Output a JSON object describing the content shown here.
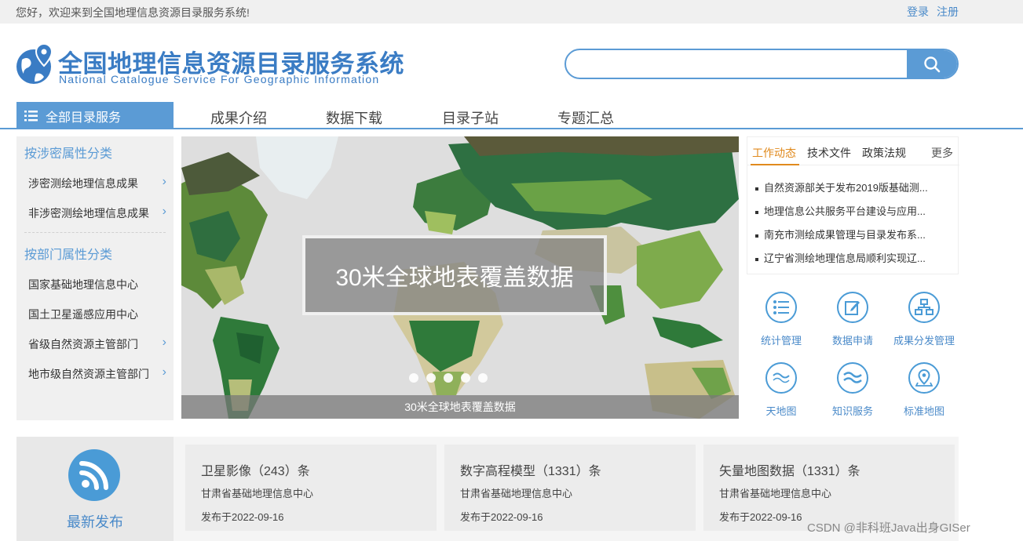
{
  "topbar": {
    "welcome": "您好，欢迎来到全国地理信息资源目录服务系统!",
    "login": "登录",
    "register": "注册"
  },
  "header": {
    "title": "全国地理信息资源目录服务系统",
    "subtitle": "National Catalogue Service For Geographic Information",
    "search_placeholder": "",
    "search_value": "",
    "search_icon": "search-icon",
    "logo_icon": "globe-pin-icon"
  },
  "nav": {
    "all_label": "全部目录服务",
    "items": [
      "成果介绍",
      "数据下载",
      "目录子站",
      "专题汇总"
    ]
  },
  "sidebar": {
    "group1_title": "按涉密属性分类",
    "group1_items": [
      "涉密测绘地理信息成果",
      "非涉密测绘地理信息成果"
    ],
    "group2_title": "按部门属性分类",
    "group2_items": [
      "国家基础地理信息中心",
      "国土卫星遥感应用中心",
      "省级自然资源主管部门",
      "地市级自然资源主管部门"
    ]
  },
  "banner": {
    "overlay_title": "30米全球地表覆盖数据",
    "caption": "30米全球地表覆盖数据",
    "slide_count": 5
  },
  "news": {
    "tabs": [
      "工作动态",
      "技术文件",
      "政策法规"
    ],
    "active_tab": 0,
    "more": "更多",
    "items": [
      "自然资源部关于发布2019版基础测...",
      "地理信息公共服务平台建设与应用...",
      "南充市测绘成果管理与目录发布系...",
      "辽宁省测绘地理信息局顺利实现辽..."
    ]
  },
  "quick_links": [
    {
      "label": "统计管理",
      "icon": "list-icon"
    },
    {
      "label": "数据申请",
      "icon": "edit-icon"
    },
    {
      "label": "成果分发管理",
      "icon": "hierarchy-icon"
    },
    {
      "label": "天地图",
      "icon": "tianditu-logo-icon"
    },
    {
      "label": "知识服务",
      "icon": "knowledge-icon"
    },
    {
      "label": "标准地图",
      "icon": "map-pin-icon"
    }
  ],
  "latest": {
    "label": "最新发布",
    "icon": "rss-icon"
  },
  "cards": [
    {
      "title": "卫星影像（243）条",
      "org": "甘肃省基础地理信息中心",
      "date": "发布于2022-09-16"
    },
    {
      "title": "数字高程模型（1331）条",
      "org": "甘肃省基础地理信息中心",
      "date": "发布于2022-09-16"
    },
    {
      "title": "矢量地图数据（1331）条",
      "org": "甘肃省基础地理信息中心",
      "date": "发布于2022-09-16"
    }
  ],
  "watermark": "CSDN @非科班Java出身GISer",
  "colors": {
    "accent": "#5b9bd5",
    "active_tab": "#e08a1e",
    "link": "#4a8ac9"
  }
}
